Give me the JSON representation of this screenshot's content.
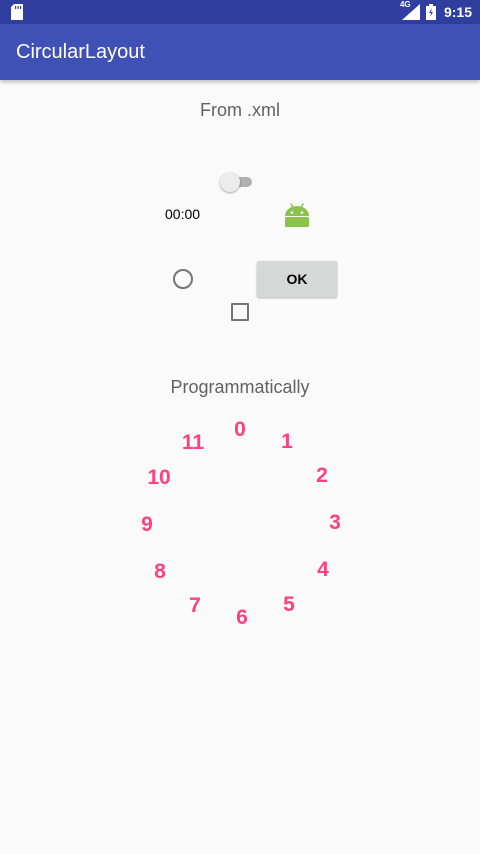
{
  "status_bar": {
    "time": "9:15",
    "network": "4G",
    "icons": [
      "sd-card-icon",
      "signal-icon",
      "battery-icon"
    ]
  },
  "app_bar": {
    "title": "CircularLayout"
  },
  "xml_section": {
    "label": "From .xml",
    "switch_on": false,
    "timer_text": "00:00",
    "button_label": "OK",
    "radio_checked": false,
    "checkbox_checked": false
  },
  "programmatic_section": {
    "label": "Programmatically",
    "numbers": [
      "0",
      "1",
      "2",
      "3",
      "4",
      "5",
      "6",
      "7",
      "8",
      "9",
      "10",
      "11"
    ]
  },
  "colors": {
    "status_bar": "#303f9f",
    "app_bar": "#3f51b5",
    "accent": "#ff4081",
    "android_green": "#8bc34a",
    "background": "#fafafa"
  }
}
